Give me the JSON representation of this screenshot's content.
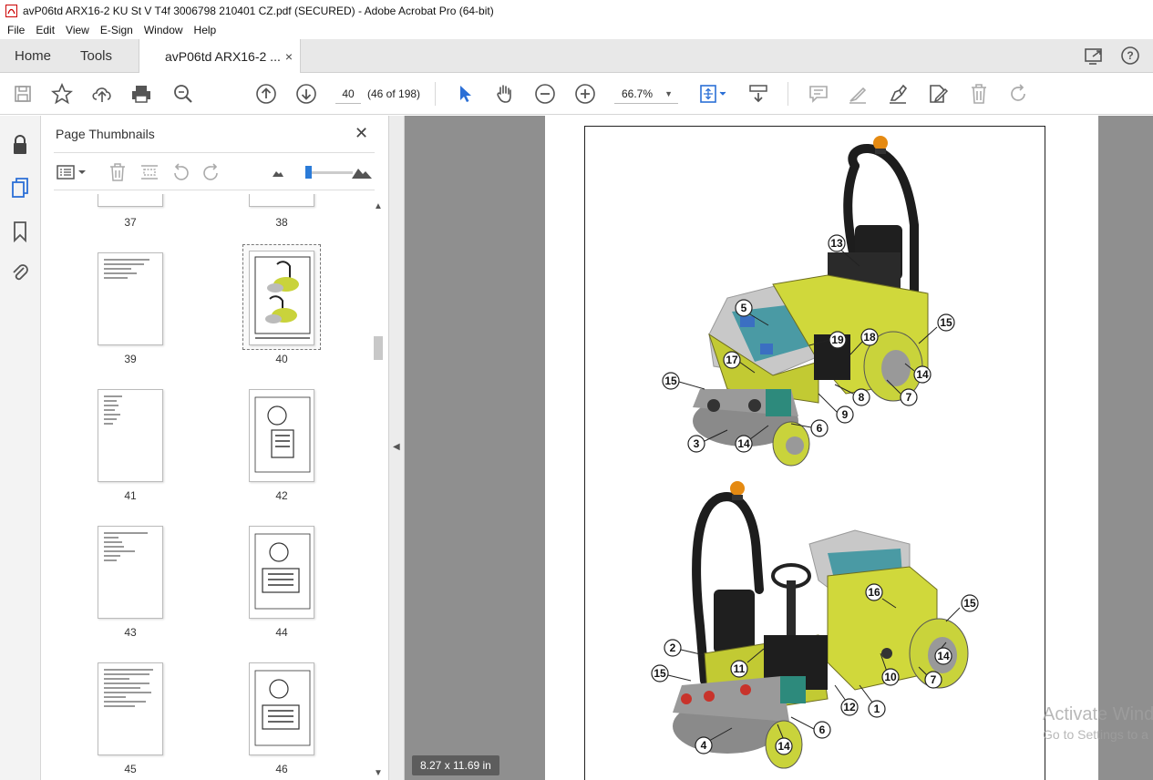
{
  "window": {
    "title": "avP06td ARX16-2 KU St V T4f 3006798 210401 CZ.pdf (SECURED) - Adobe Acrobat Pro (64-bit)"
  },
  "menu": [
    "File",
    "Edit",
    "View",
    "E-Sign",
    "Window",
    "Help"
  ],
  "tabs": {
    "home": "Home",
    "tools": "Tools",
    "document": "avP06td ARX16-2 ...",
    "close_glyph": "×"
  },
  "toolbar": {
    "page_number": "40",
    "page_count": "(46 of 198)",
    "zoom": "66.7%"
  },
  "thumbnail_panel": {
    "title": "Page Thumbnails",
    "close_glyph": "✕",
    "pages": [
      {
        "label": "37"
      },
      {
        "label": "38"
      },
      {
        "label": "39"
      },
      {
        "label": "40",
        "selected": true
      },
      {
        "label": "41"
      },
      {
        "label": "42"
      },
      {
        "label": "43"
      },
      {
        "label": "44"
      },
      {
        "label": "45"
      },
      {
        "label": "46"
      }
    ]
  },
  "document": {
    "page_size_label": "8.27 x 11.69 in",
    "callouts_top": [
      "13",
      "5",
      "19",
      "18",
      "15",
      "17",
      "15",
      "14",
      "7",
      "8",
      "9",
      "6",
      "3",
      "14"
    ],
    "callouts_bottom": [
      "16",
      "15",
      "2",
      "11",
      "14",
      "15",
      "10",
      "7",
      "12",
      "1",
      "6",
      "4",
      "14"
    ]
  },
  "watermark": {
    "line1": "Activate Windo",
    "line2": "Go to Settings to a"
  },
  "colors": {
    "machine_body": "#cfd83a",
    "accent_blue": "#2b7bd8",
    "viewer_bg": "#8f8f8f"
  }
}
